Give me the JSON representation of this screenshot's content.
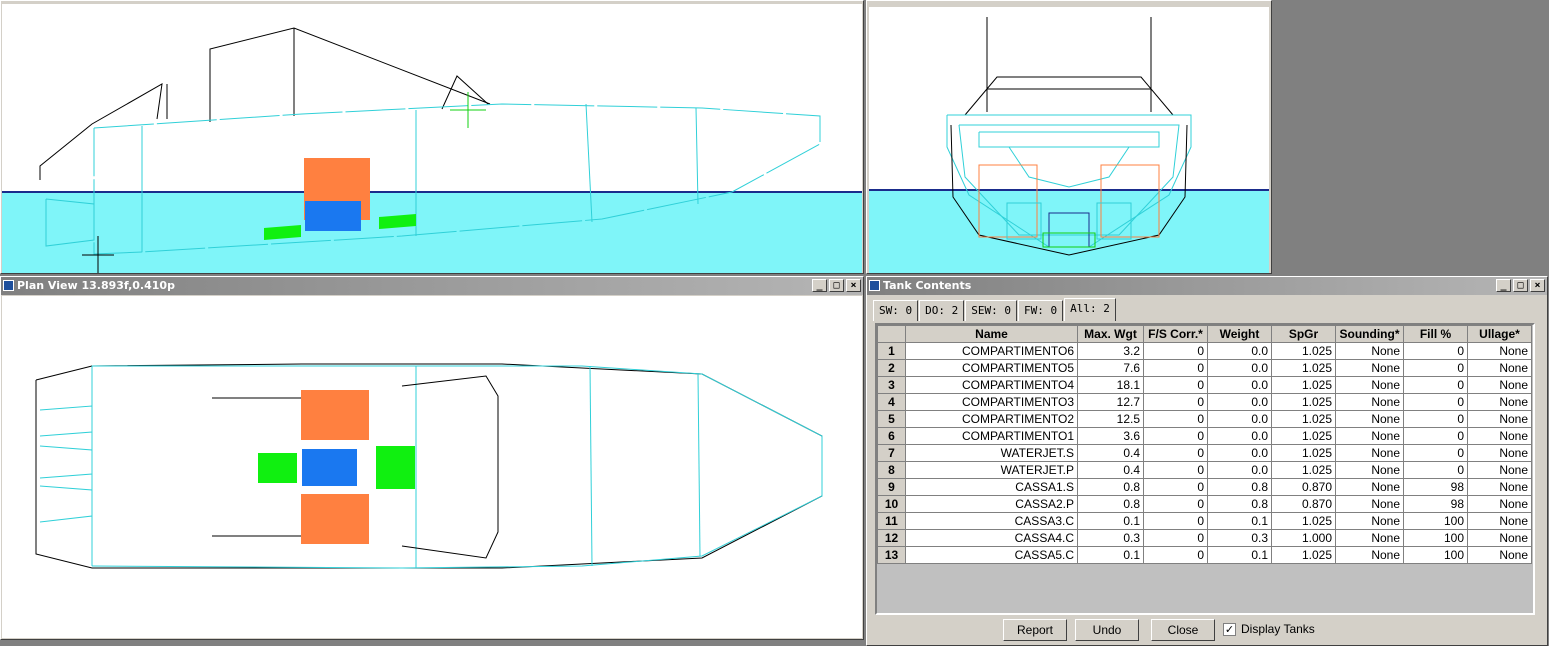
{
  "windows": {
    "plan_view": {
      "title": "Plan View 13.893f,0.410p"
    },
    "tank_contents": {
      "title": "Tank Contents",
      "tabs": [
        "SW: 0",
        "DO: 2",
        "SEW: 0",
        "FW: 0",
        "All: 2"
      ],
      "active_tab": "All: 2",
      "columns": [
        "Name",
        "Max. Wgt",
        "F/S Corr.*",
        "Weight",
        "SpGr",
        "Sounding*",
        "Fill %",
        "Ullage*"
      ],
      "rows": [
        {
          "num": "1",
          "name": "COMPARTIMENTO6",
          "max": "3.2",
          "fs": "0",
          "weight": "0.0",
          "spgr": "1.025",
          "sounding": "None",
          "fill": "0",
          "ullage": "None"
        },
        {
          "num": "2",
          "name": "COMPARTIMENTO5",
          "max": "7.6",
          "fs": "0",
          "weight": "0.0",
          "spgr": "1.025",
          "sounding": "None",
          "fill": "0",
          "ullage": "None"
        },
        {
          "num": "3",
          "name": "COMPARTIMENTO4",
          "max": "18.1",
          "fs": "0",
          "weight": "0.0",
          "spgr": "1.025",
          "sounding": "None",
          "fill": "0",
          "ullage": "None"
        },
        {
          "num": "4",
          "name": "COMPARTIMENTO3",
          "max": "12.7",
          "fs": "0",
          "weight": "0.0",
          "spgr": "1.025",
          "sounding": "None",
          "fill": "0",
          "ullage": "None"
        },
        {
          "num": "5",
          "name": "COMPARTIMENTO2",
          "max": "12.5",
          "fs": "0",
          "weight": "0.0",
          "spgr": "1.025",
          "sounding": "None",
          "fill": "0",
          "ullage": "None"
        },
        {
          "num": "6",
          "name": "COMPARTIMENTO1",
          "max": "3.6",
          "fs": "0",
          "weight": "0.0",
          "spgr": "1.025",
          "sounding": "None",
          "fill": "0",
          "ullage": "None"
        },
        {
          "num": "7",
          "name": "WATERJET.S",
          "max": "0.4",
          "fs": "0",
          "weight": "0.0",
          "spgr": "1.025",
          "sounding": "None",
          "fill": "0",
          "ullage": "None"
        },
        {
          "num": "8",
          "name": "WATERJET.P",
          "max": "0.4",
          "fs": "0",
          "weight": "0.0",
          "spgr": "1.025",
          "sounding": "None",
          "fill": "0",
          "ullage": "None"
        },
        {
          "num": "9",
          "name": "CASSA1.S",
          "max": "0.8",
          "fs": "0",
          "weight": "0.8",
          "spgr": "0.870",
          "sounding": "None",
          "fill": "98",
          "ullage": "None"
        },
        {
          "num": "10",
          "name": "CASSA2.P",
          "max": "0.8",
          "fs": "0",
          "weight": "0.8",
          "spgr": "0.870",
          "sounding": "None",
          "fill": "98",
          "ullage": "None"
        },
        {
          "num": "11",
          "name": "CASSA3.C",
          "max": "0.1",
          "fs": "0",
          "weight": "0.1",
          "spgr": "1.025",
          "sounding": "None",
          "fill": "100",
          "ullage": "None"
        },
        {
          "num": "12",
          "name": "CASSA4.C",
          "max": "0.3",
          "fs": "0",
          "weight": "0.3",
          "spgr": "1.000",
          "sounding": "None",
          "fill": "100",
          "ullage": "None"
        },
        {
          "num": "13",
          "name": "CASSA5.C",
          "max": "0.1",
          "fs": "0",
          "weight": "0.1",
          "spgr": "1.025",
          "sounding": "None",
          "fill": "100",
          "ullage": "None"
        }
      ],
      "buttons": {
        "report": "Report",
        "undo": "Undo",
        "close": "Close"
      },
      "display_tanks": {
        "label": "Display Tanks",
        "checked": true,
        "check_glyph": "✓"
      }
    }
  },
  "title_buttons": {
    "minimize": "_",
    "maximize": "□",
    "close": "×"
  },
  "colors": {
    "water": "#7ff5f9",
    "waterline": "#1a2c8c",
    "hull_lines": "#30d0d8",
    "tank_orange": "#ff8040",
    "tank_blue": "#1a78f0",
    "tank_green": "#10f010"
  }
}
